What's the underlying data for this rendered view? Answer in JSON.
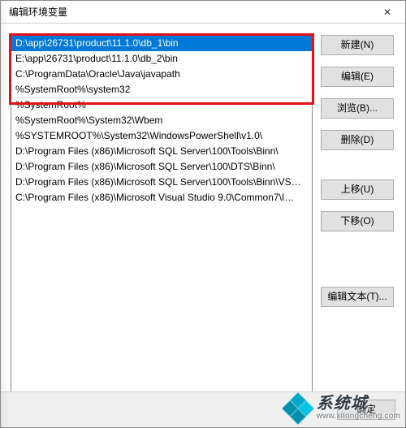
{
  "window": {
    "title": "编辑环境变量"
  },
  "list": {
    "items": [
      "D:\\app\\26731\\product\\11.1.0\\db_1\\bin",
      "E:\\app\\26731\\product\\11.1.0\\db_2\\bin",
      "C:\\ProgramData\\Oracle\\Java\\javapath",
      "%SystemRoot%\\system32",
      "%SystemRoot%",
      "%SystemRoot%\\System32\\Wbem",
      "%SYSTEMROOT%\\System32\\WindowsPowerShell\\v1.0\\",
      "D:\\Program Files (x86)\\Microsoft SQL Server\\100\\Tools\\Binn\\",
      "D:\\Program Files (x86)\\Microsoft SQL Server\\100\\DTS\\Binn\\",
      "D:\\Program Files (x86)\\Microsoft SQL Server\\100\\Tools\\Binn\\VS…",
      "C:\\Program Files (x86)\\Microsoft Visual Studio 9.0\\Common7\\I…"
    ],
    "selected_index": 0
  },
  "buttons": {
    "new": "新建(N)",
    "edit": "编辑(E)",
    "browse": "浏览(B)...",
    "delete": "删除(D)",
    "move_up": "上移(U)",
    "move_down": "下移(O)",
    "edit_text": "编辑文本(T)...",
    "ok": "确定"
  },
  "icons": {
    "close": "✕"
  },
  "watermark": {
    "brand": "系统城",
    "url": "www.xitongcheng.com"
  }
}
